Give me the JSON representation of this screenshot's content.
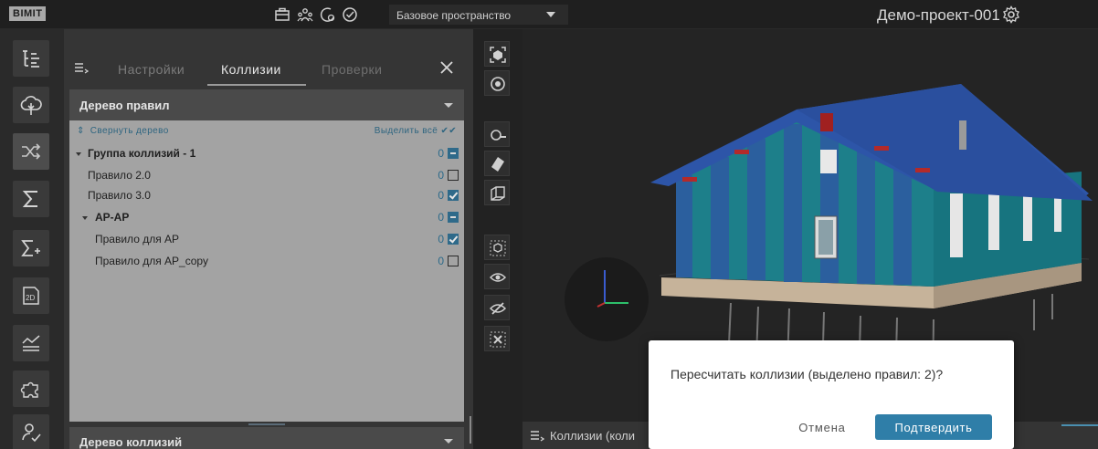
{
  "topbar": {
    "logo": "BIMIT",
    "icons": [
      "briefcase-icon",
      "team-icon",
      "settings-check-icon",
      "check-circle-icon"
    ],
    "space_label": "Базовое пространство",
    "project_name": "Демо-проект-001"
  },
  "sidebar": {
    "items": [
      {
        "icon": "tree-structure-icon"
      },
      {
        "icon": "cloud-tree-icon"
      },
      {
        "icon": "shuffle-collisions-icon",
        "active": true
      },
      {
        "icon": "sigma-icon"
      },
      {
        "icon": "sigma-plus-icon"
      },
      {
        "icon": "2d-sheet-icon"
      },
      {
        "icon": "chart-trend-icon"
      },
      {
        "icon": "puzzle-icon"
      },
      {
        "icon": "user-check-icon"
      }
    ]
  },
  "panel": {
    "tabs": [
      {
        "label": "Настройки"
      },
      {
        "label": "Коллизии",
        "active": true
      },
      {
        "label": "Проверки"
      }
    ],
    "rules_tree_title": "Дерево правил",
    "collapse_label": "Свернуть дерево",
    "select_all_label": "Выделить всё",
    "tree": [
      {
        "label": "Группа коллизий - 1",
        "count": "0",
        "state": "partial",
        "level": 0,
        "group": true
      },
      {
        "label": "Правило 2.0",
        "count": "0",
        "state": "unchecked",
        "level": 1
      },
      {
        "label": "Правило 3.0",
        "count": "0",
        "state": "checked",
        "level": 1
      },
      {
        "label": "АР-АР",
        "count": "0",
        "state": "partial",
        "level": 1,
        "group": true
      },
      {
        "label": "Правило для АР",
        "count": "0",
        "state": "checked",
        "level": 2
      },
      {
        "label": "Правило для АР_copy",
        "count": "0",
        "state": "unchecked",
        "level": 2
      }
    ],
    "collisions_tree_title": "Дерево коллизий"
  },
  "viewer_tools": [
    "fit-view-icon",
    "target-icon",
    "camera-icon",
    "section-plane-icon",
    "section-box-icon",
    "isolate-icon",
    "show-icon",
    "hide-icon",
    "clear-icon"
  ],
  "bottom": {
    "label": "Коллизии (коли"
  },
  "dialog": {
    "message": "Пересчитать коллизии (выделено правил: 2)?",
    "cancel": "Отмена",
    "confirm": "Подтвердить"
  },
  "colors": {
    "accent": "#2f7ea8",
    "panel": "#353535",
    "tree_bg": "#a3a3a3"
  }
}
